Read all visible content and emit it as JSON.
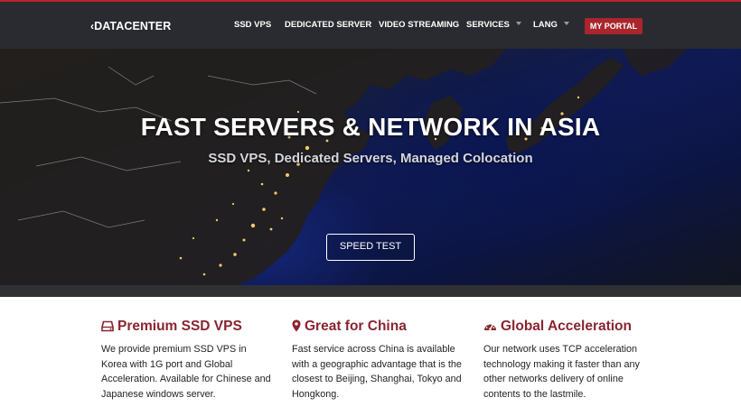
{
  "header": {
    "logo": "DATACENTER",
    "logo_mark": "‹",
    "nav": [
      {
        "label": "SSD VPS"
      },
      {
        "label": "DEDICATED SERVER"
      },
      {
        "label": "VIDEO STREAMING"
      },
      {
        "label": "SERVICES"
      },
      {
        "label": "LANG"
      }
    ],
    "portal_label": "MY PORTAL"
  },
  "hero": {
    "title": "FAST SERVERS & NETWORK IN ASIA",
    "subtitle": "SSD VPS, Dedicated Servers, Managed Colocation",
    "button_label": "SPEED TEST"
  },
  "features": [
    {
      "icon": "hdd-icon",
      "title": "Premium SSD VPS",
      "text": "We provide premium SSD VPS in Korea with 1G port and Global Acceleration. Available for Chinese and Japanese windows server."
    },
    {
      "icon": "map-marker-icon",
      "title": "Great for China",
      "text": "Fast service across China is available with a geographic advantage that is the closest to Beijing, Shanghai, Tokyo and Hongkong."
    },
    {
      "icon": "dashboard-icon",
      "title": "Global Acceleration",
      "text": "Our network uses TCP acceleration technology making it faster than any other networks delivery of online contents to the lastmile."
    }
  ],
  "colors": {
    "accent": "#8a2430",
    "portal": "#a8262c",
    "navbar": "#2a2b30"
  }
}
